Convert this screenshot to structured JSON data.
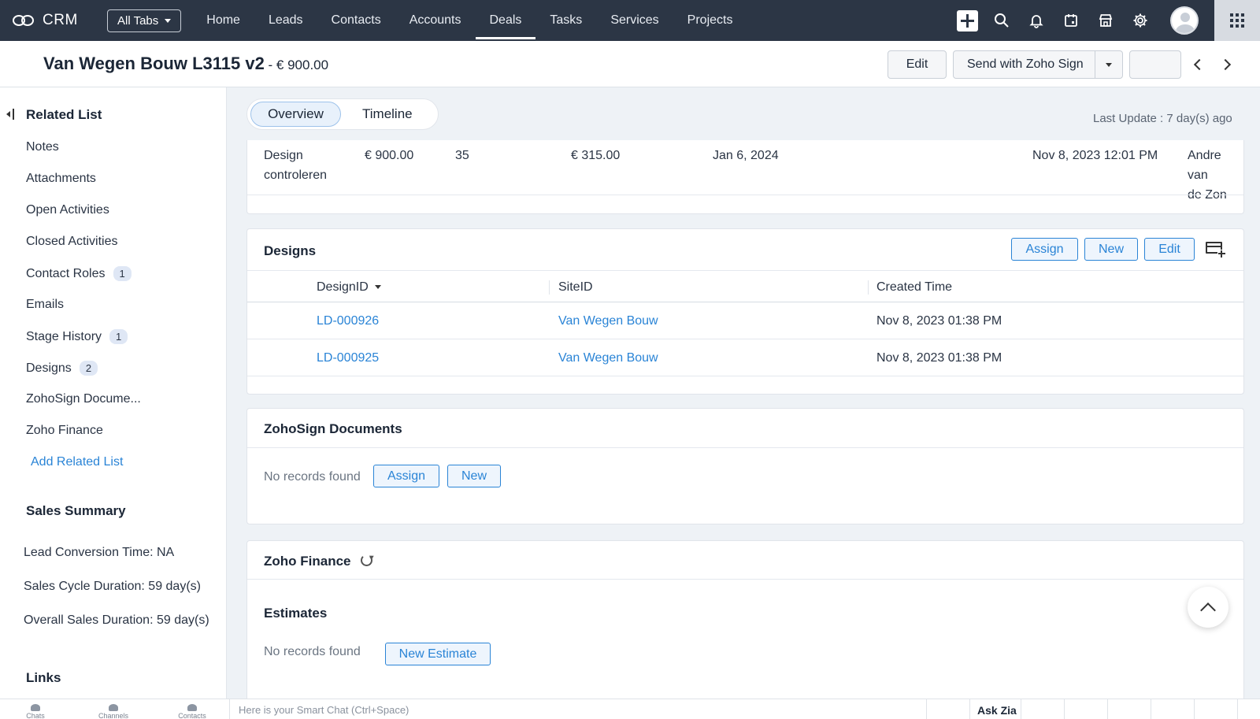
{
  "nav": {
    "app_name": "CRM",
    "all_tabs": "All Tabs",
    "tabs": [
      {
        "label": "Home"
      },
      {
        "label": "Leads"
      },
      {
        "label": "Contacts"
      },
      {
        "label": "Accounts"
      },
      {
        "label": "Deals"
      },
      {
        "label": "Tasks"
      },
      {
        "label": "Services"
      },
      {
        "label": "Projects"
      }
    ],
    "active_tab": "Deals"
  },
  "header": {
    "title": "Van Wegen Bouw L3115 v2",
    "amount": " - € 900.00",
    "edit_label": "Edit",
    "sign_label": "Send with Zoho Sign"
  },
  "sidebar": {
    "related_list_title": "Related List",
    "items": [
      {
        "label": "Notes",
        "badge": ""
      },
      {
        "label": "Attachments",
        "badge": ""
      },
      {
        "label": "Open Activities",
        "badge": ""
      },
      {
        "label": "Closed Activities",
        "badge": ""
      },
      {
        "label": "Contact Roles",
        "badge": "1"
      },
      {
        "label": "Emails",
        "badge": ""
      },
      {
        "label": "Stage History",
        "badge": "1"
      },
      {
        "label": "Designs",
        "badge": "2"
      },
      {
        "label": "ZohoSign Docume...",
        "badge": ""
      },
      {
        "label": "Zoho Finance",
        "badge": ""
      }
    ],
    "add_related": "Add Related List",
    "sales_summary_title": "Sales Summary",
    "summary": [
      "Lead Conversion Time: NA",
      "Sales Cycle Duration: 59 day(s)",
      "Overall Sales Duration: 59 day(s)"
    ],
    "links_title": "Links"
  },
  "content": {
    "tab_overview": "Overview",
    "tab_timeline": "Timeline",
    "last_update": "Last Update : 7 day(s) ago",
    "stage_row": {
      "stage_line1": "Design",
      "stage_line2": "controleren",
      "amount": "€ 900.00",
      "probability": "35",
      "expected": "€ 315.00",
      "closing_date": "Jan 6, 2024",
      "modified_time": "Nov 8, 2023 12:01 PM",
      "modified_by_line1": "Andre van",
      "modified_by_line2": "de Zon"
    },
    "designs": {
      "title": "Designs",
      "assign": "Assign",
      "new": "New",
      "edit": "Edit",
      "columns": [
        "DesignID",
        "SiteID",
        "Created Time"
      ],
      "rows": [
        {
          "design_id": "LD-000926",
          "site_id": "Van Wegen Bouw",
          "created": "Nov 8, 2023 01:38 PM"
        },
        {
          "design_id": "LD-000925",
          "site_id": "Van Wegen Bouw",
          "created": "Nov 8, 2023 01:38 PM"
        }
      ]
    },
    "zohosign": {
      "title": "ZohoSign Documents",
      "empty": "No records found",
      "assign": "Assign",
      "new": "New"
    },
    "finance": {
      "title": "Zoho Finance",
      "estimates_title": "Estimates",
      "empty": "No records found",
      "new_estimate": "New Estimate"
    }
  },
  "bottom": {
    "chats": "Chats",
    "channels": "Channels",
    "contacts": "Contacts",
    "smart_chat_placeholder": "Here is your Smart Chat (Ctrl+Space)",
    "ask_zia": "Ask Zia"
  },
  "colors": {
    "nav_bg": "#2c3645",
    "accent": "#2a84d6",
    "page_bg": "#eef2f6"
  }
}
